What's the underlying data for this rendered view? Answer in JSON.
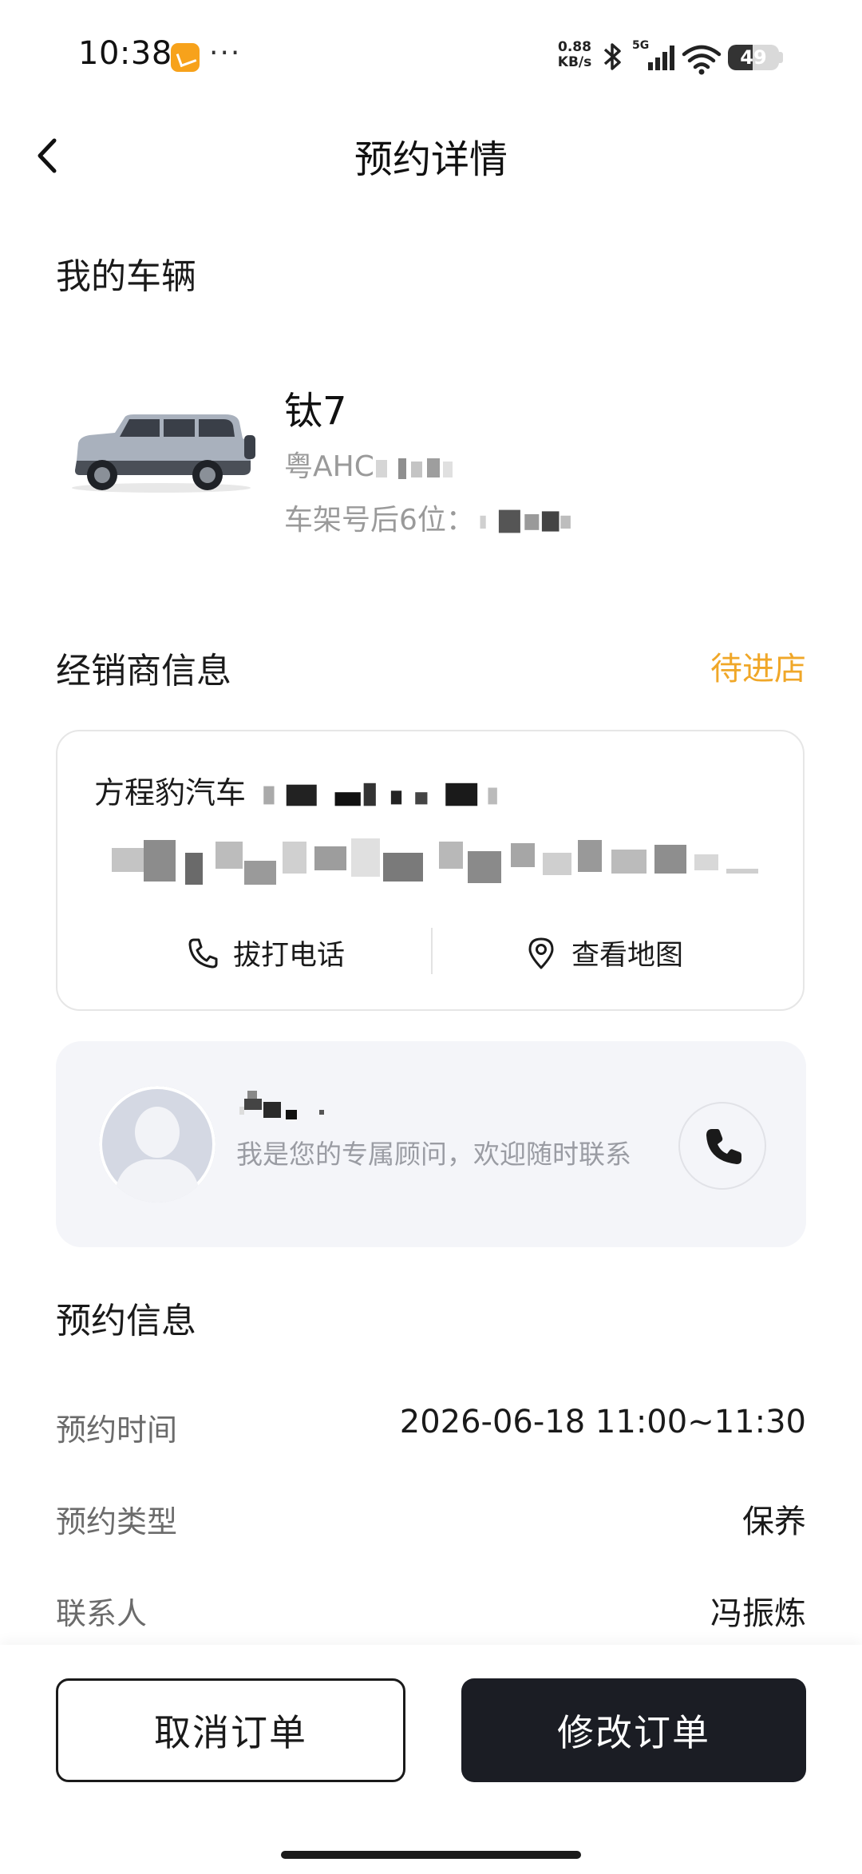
{
  "status_bar": {
    "time": "10:38",
    "more": "···",
    "net_speed_value": "0.88",
    "net_speed_unit": "KB/s",
    "network": "5G",
    "battery": "49"
  },
  "header": {
    "title": "预约详情"
  },
  "vehicle_section": {
    "title": "我的车辆",
    "model": "钛7",
    "plate_prefix": "粤AHC",
    "vin_label": "车架号后6位："
  },
  "dealer_section": {
    "title": "经销商信息",
    "status": "待进店",
    "status_color": "#f0a728",
    "dealer_name_prefix": "方程豹汽车",
    "call_label": "拔打电话",
    "map_label": "查看地图"
  },
  "advisor": {
    "description": "我是您的专属顾问，欢迎随时联系"
  },
  "appointment_section": {
    "title": "预约信息",
    "rows": [
      {
        "label": "预约时间",
        "value": "2026-06-18 11:00~11:30"
      },
      {
        "label": "预约类型",
        "value": "保养"
      },
      {
        "label": "联系人",
        "value": "冯振炼"
      }
    ]
  },
  "footer": {
    "cancel_label": "取消订单",
    "modify_label": "修改订单"
  }
}
